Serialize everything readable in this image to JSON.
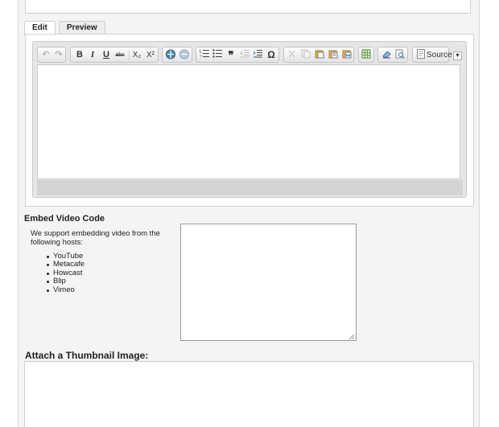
{
  "tabs": [
    {
      "label": "Edit"
    },
    {
      "label": "Preview"
    }
  ],
  "toolbar": {
    "undo_icon": "undo-icon",
    "redo_icon": "redo-icon",
    "bold": "B",
    "italic": "I",
    "underline": "U",
    "strike": "abc",
    "subscript": "X₂",
    "superscript": "X²",
    "source_label": "Source"
  },
  "embed": {
    "title": "Embed Video Code",
    "description": "We support embedding video from the following hosts:",
    "hosts": [
      "YouTube",
      "Metacafe",
      "Howcast",
      "Blip",
      "Vimeo"
    ],
    "textarea_value": ""
  },
  "thumbnail": {
    "title": "Attach a Thumbnail Image:"
  }
}
